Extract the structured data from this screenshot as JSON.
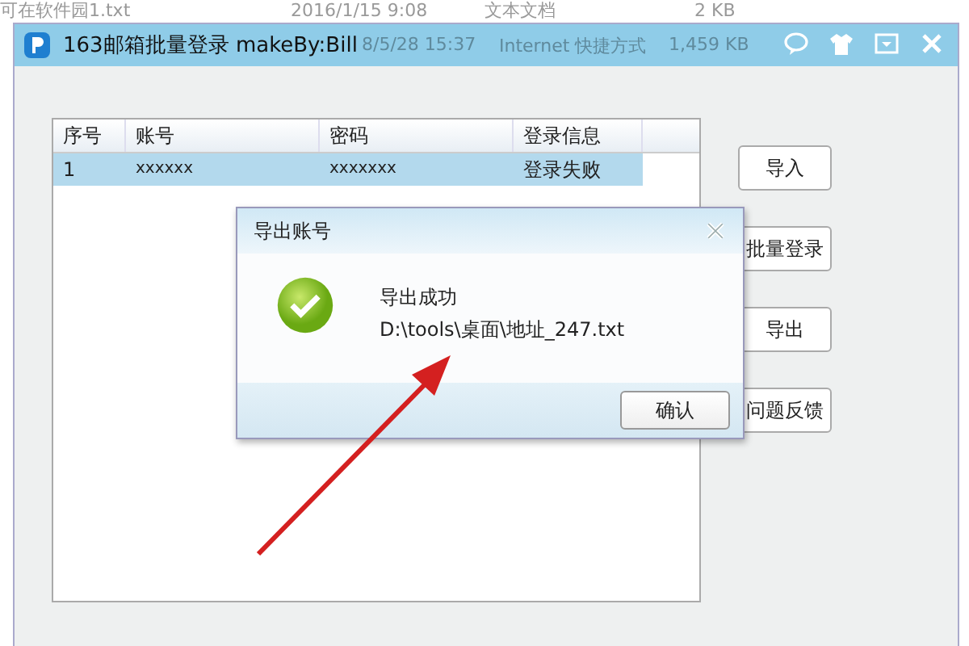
{
  "desktop_files": [
    {
      "name": "可在软件园1.txt",
      "modified": "2016/1/15 9:08",
      "type": "文本文档",
      "size": "2 KB"
    },
    {
      "modified": "8/5/28 15:37",
      "type": "Internet 快捷方式",
      "size": "1,459 KB"
    }
  ],
  "window": {
    "title": "163邮箱批量登录 makeBy:Bill"
  },
  "table": {
    "columns": [
      "序号",
      "账号",
      "密码",
      "登录信息"
    ],
    "rows": [
      {
        "cells": [
          "1",
          "xxxxxx",
          "xxxxxxx",
          "登录失败"
        ],
        "selected": true
      }
    ]
  },
  "buttons": [
    "导入",
    "批量登录",
    "导出",
    "问题反馈"
  ],
  "dialog": {
    "title": "导出账号",
    "message": "导出成功",
    "path": "D:\\tools\\桌面\\地址_247.txt",
    "buttons": [
      "确认"
    ]
  }
}
